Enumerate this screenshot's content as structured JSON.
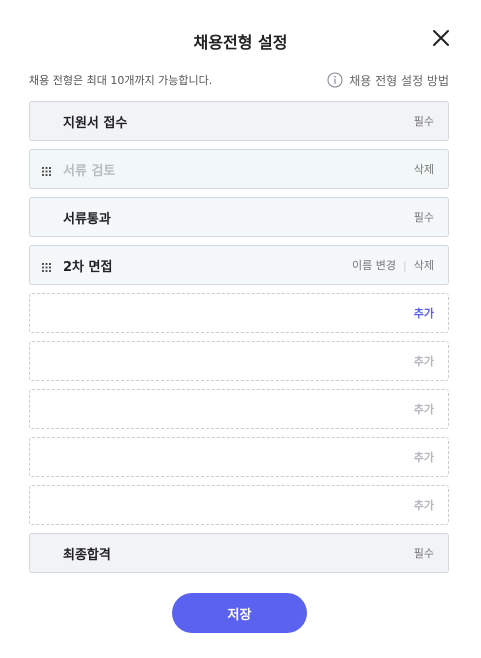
{
  "dialog": {
    "title": "채용전형 설정",
    "hint": "채용 전형은 최대 10개까지 가능합니다.",
    "guide_label": "채용 전형 설정 방법",
    "save_label": "저장"
  },
  "steps": [
    {
      "label": "지원서 접수",
      "badge": "필수"
    },
    {
      "label": "서류 검토",
      "delete": "삭제"
    },
    {
      "label": "서류통과",
      "badge": "필수"
    },
    {
      "label": "2차 면접",
      "rename": "이름 변경",
      "delete": "삭제"
    },
    {
      "add": "추가"
    },
    {
      "add": "추가"
    },
    {
      "add": "추가"
    },
    {
      "add": "추가"
    },
    {
      "add": "추가"
    },
    {
      "label": "최종합격",
      "badge": "필수"
    }
  ],
  "colors": {
    "accent": "#5b62ef",
    "add_active": "#5b5fe8"
  }
}
